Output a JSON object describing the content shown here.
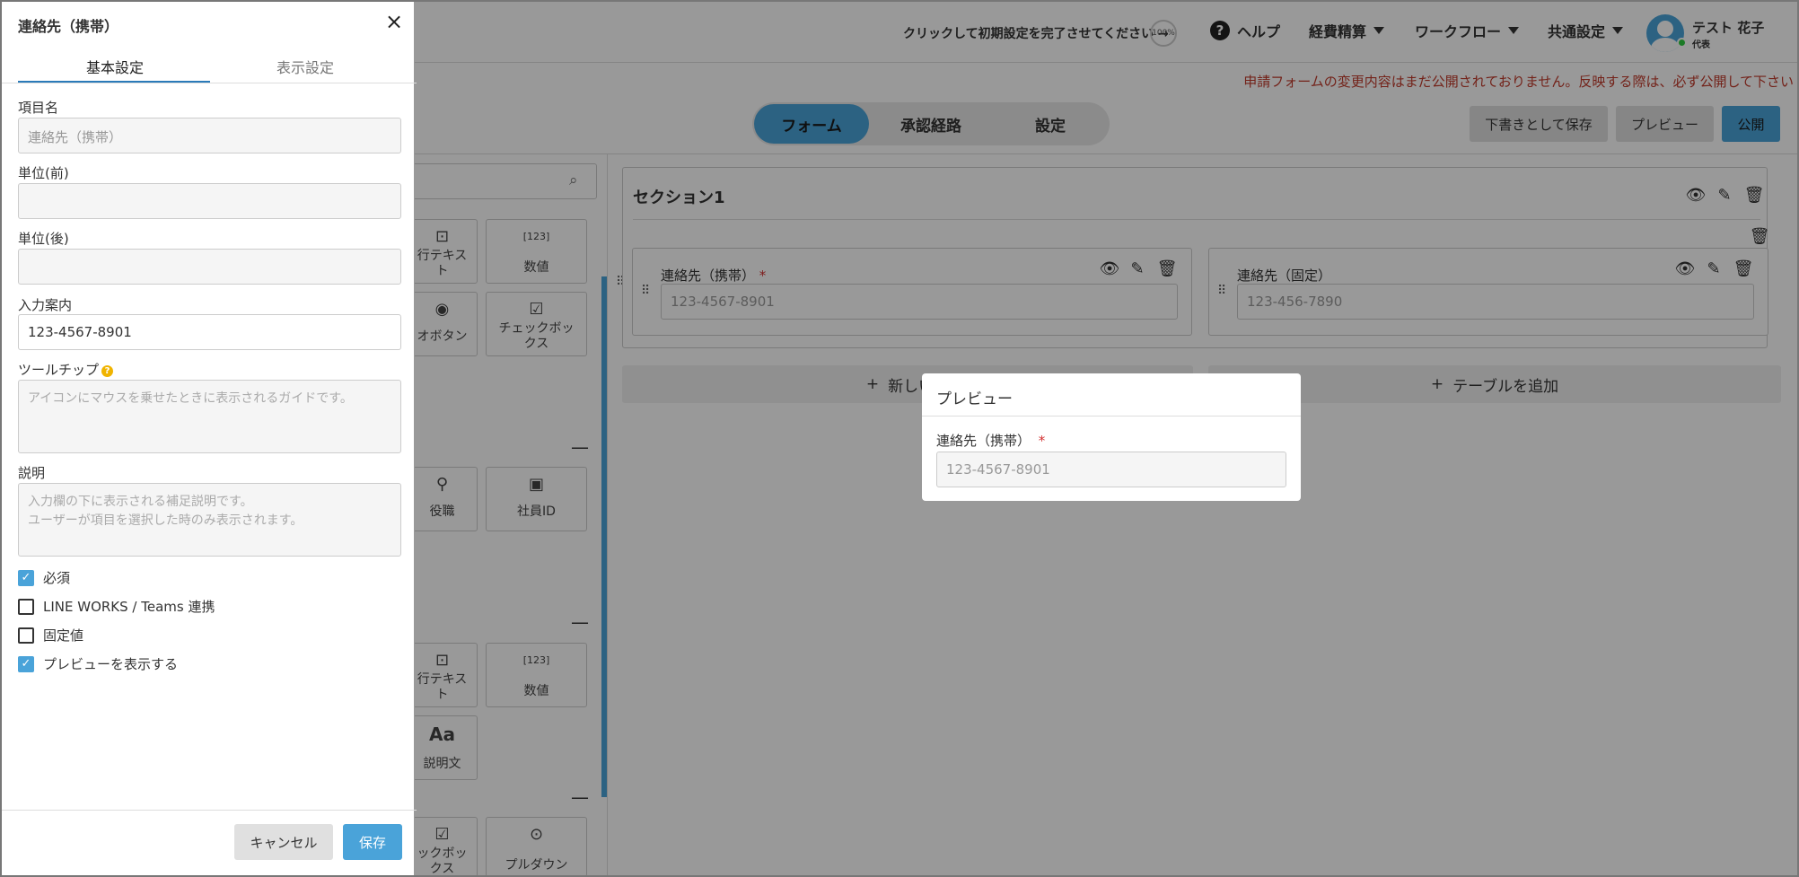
{
  "header": {
    "setup_prompt": "クリックして初期設定を完了させてください →",
    "setup_progress": "100%",
    "help": "ヘルプ",
    "menus": [
      "経費精算",
      "ワークフロー",
      "共通設定"
    ],
    "user_name": "テスト 花子",
    "user_role": "代表"
  },
  "notice": "申請フォームの変更内容はまだ公開されておりません。反映する際は、必ず公開して下さい",
  "tabs": {
    "form": "フォーム",
    "route": "承認経路",
    "settings": "設定"
  },
  "actions": {
    "draft": "下書きとして保存",
    "preview": "プレビュー",
    "publish": "公開"
  },
  "palette": {
    "items": [
      {
        "label": "行テキスト\nト",
        "icon": "text-icon"
      },
      {
        "label": "数値",
        "icon": "number-icon"
      },
      {
        "label": "オボタン",
        "icon": "radio-icon"
      },
      {
        "label": "チェックボックス",
        "icon": "checkbox-icon"
      },
      {
        "label": "役職",
        "icon": "position-icon"
      },
      {
        "label": "社員ID",
        "icon": "id-icon"
      },
      {
        "label": "行テキスト",
        "icon": "text-icon"
      },
      {
        "label": "数値",
        "icon": "number-icon"
      },
      {
        "label": "説明文",
        "icon": "description-icon"
      },
      {
        "label": "ックボックス",
        "icon": "checkbox-icon"
      },
      {
        "label": "プルダウン",
        "icon": "dropdown-icon"
      }
    ],
    "text_line1": "行テキス",
    "text_line2": "ト",
    "number": "数値",
    "radio": "オボタン",
    "checkbox1": "チェックボッ",
    "checkbox2": "クス",
    "position": "役職",
    "empid": "社員ID",
    "aa": "Aa",
    "desc": "説明文",
    "checkbox3": "ックボッ",
    "checkbox4": "クス",
    "pulldown": "プルダウン"
  },
  "section": {
    "title": "セクション1",
    "fields": [
      {
        "label": "連絡先（携帯）",
        "required": "*",
        "placeholder": "123-4567-8901"
      },
      {
        "label": "連絡先（固定）",
        "placeholder": "123-456-7890"
      }
    ],
    "add_section": "新しいセ",
    "add_table": "テーブルを追加"
  },
  "preview_modal": {
    "title": "プレビュー",
    "label": "連絡先（携帯）",
    "required": "*",
    "placeholder": "123-4567-8901"
  },
  "drawer": {
    "title": "連絡先（携帯）",
    "tabs": [
      "基本設定",
      "表示設定"
    ],
    "item_name_label": "項目名",
    "item_name_value": "連絡先（携帯）",
    "unit_before_label": "単位(前)",
    "unit_after_label": "単位(後)",
    "hint_label": "入力案内",
    "hint_value": "123-4567-8901",
    "tooltip_label": "ツールチップ",
    "tooltip_placeholder": "アイコンにマウスを乗せたときに表示されるガイドです。",
    "desc_label": "説明",
    "desc_placeholder_1": "入力欄の下に表示される補足説明です。",
    "desc_placeholder_2": "ユーザーが項目を選択した時のみ表示されます。",
    "checks": [
      {
        "label": "必須",
        "checked": true
      },
      {
        "label": "LINE WORKS / Teams 連携",
        "checked": false
      },
      {
        "label": "固定値",
        "checked": false
      },
      {
        "label": "プレビューを表示する",
        "checked": true
      }
    ],
    "cancel": "キャンセル",
    "save": "保存"
  }
}
